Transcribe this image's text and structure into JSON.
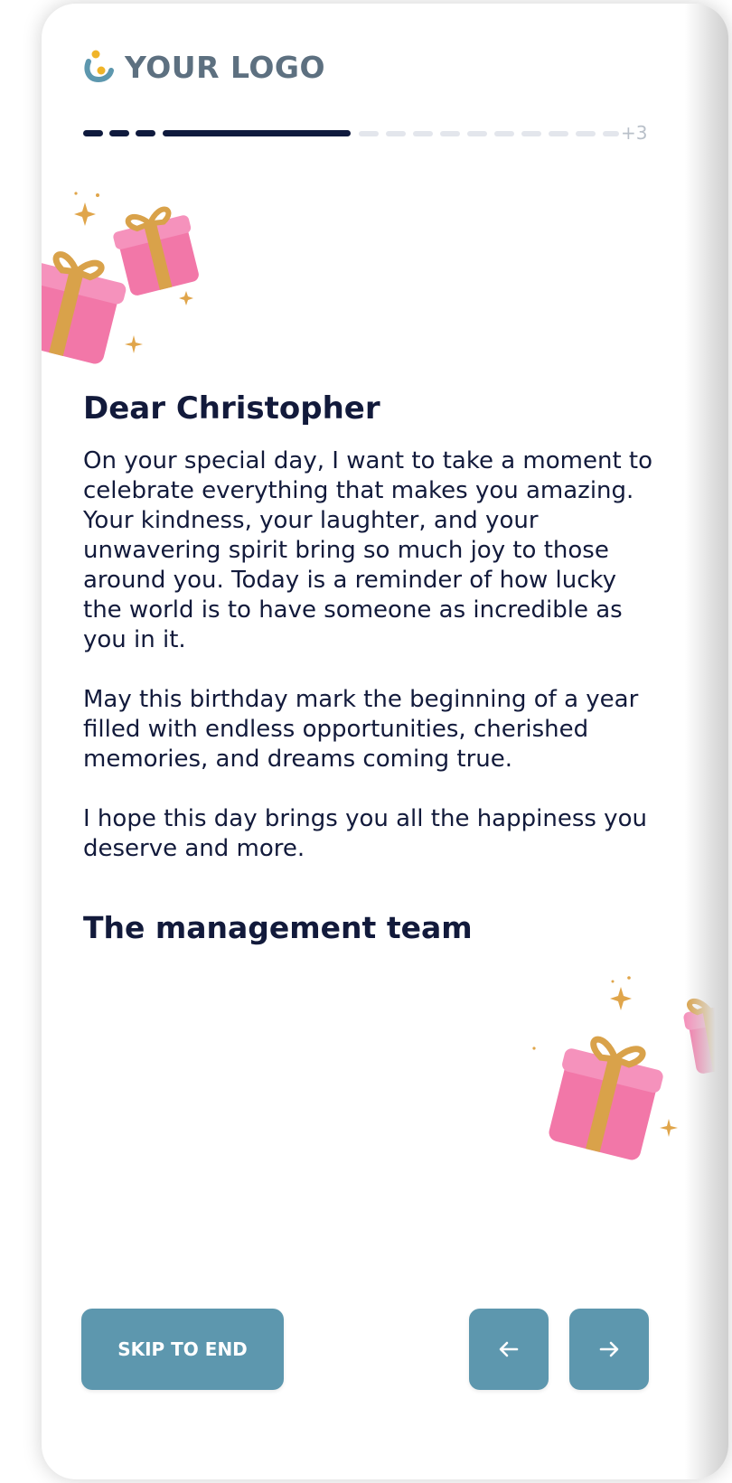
{
  "logo": {
    "text": "YOUR LOGO",
    "icon": "logo-mark-icon"
  },
  "progress": {
    "completed_steps": 3,
    "current_step": 4,
    "visible_remaining_steps": 10,
    "more_label": "+3"
  },
  "letter": {
    "greeting": "Dear Christopher",
    "paragraphs": [
      "On your special day, I want to take a moment to celebrate everything that makes you amazing. Your kindness, your laughter, and your unwavering spirit bring so much joy to those around you. Today is a reminder of how lucky the world is to have someone as incredible as you in it.",
      "May this birthday mark the beginning of a year filled with endless opportunities, cherished memories, and dreams coming true.",
      "I hope this day brings you all the happiness you deserve and more."
    ],
    "signoff": "The management team"
  },
  "nav": {
    "skip_label": "SKIP TO END",
    "prev_icon": "arrow-left-icon",
    "next_icon": "arrow-right-icon"
  },
  "colors": {
    "text": "#121a3b",
    "button": "#5d97ae",
    "progress_done": "#0f1a3d",
    "progress_todo": "#e3e6ec",
    "gift_pink": "#f277a8",
    "ribbon_gold": "#d9a24a"
  }
}
